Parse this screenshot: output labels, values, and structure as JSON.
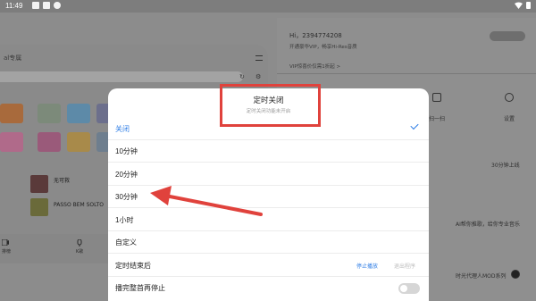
{
  "status_bar": {
    "time": "11:49"
  },
  "left_panel": {
    "title_fragment": "al专属",
    "songs": [
      {
        "title": "无可救"
      },
      {
        "title": "PASSO BEM SOLTO"
      }
    ],
    "bottom_nav": [
      "排榜",
      "K歌"
    ]
  },
  "right_panel": {
    "greeting": "Hi，2394774208",
    "vip_line": "开通豪华VIP，畅享Hi-Res音质",
    "promo": "VIP惊喜价仅需1折起 >",
    "scan_label": "扫一扫",
    "settings_label": "设置",
    "minutes_label": "30分钟上线",
    "recommend_label": "AI帮你推歌，给你专业音乐",
    "mod_label": "时光代理人MOD系列"
  },
  "dialog": {
    "title": "定时关闭",
    "subtitle": "定时关闭功能未开启",
    "options": [
      {
        "label": "关闭",
        "selected": true
      },
      {
        "label": "10分钟",
        "selected": false
      },
      {
        "label": "20分钟",
        "selected": false
      },
      {
        "label": "30分钟",
        "selected": false
      },
      {
        "label": "1小时",
        "selected": false
      },
      {
        "label": "自定义",
        "selected": false
      }
    ],
    "end_row": {
      "label": "定时结束后",
      "action_primary": "停止播放",
      "action_secondary": "退出程序"
    },
    "finish_row": {
      "label": "播完整首再停止",
      "toggle_on": false
    }
  },
  "colors": {
    "accent": "#2f7ee6",
    "annotation": "#e0423c"
  }
}
